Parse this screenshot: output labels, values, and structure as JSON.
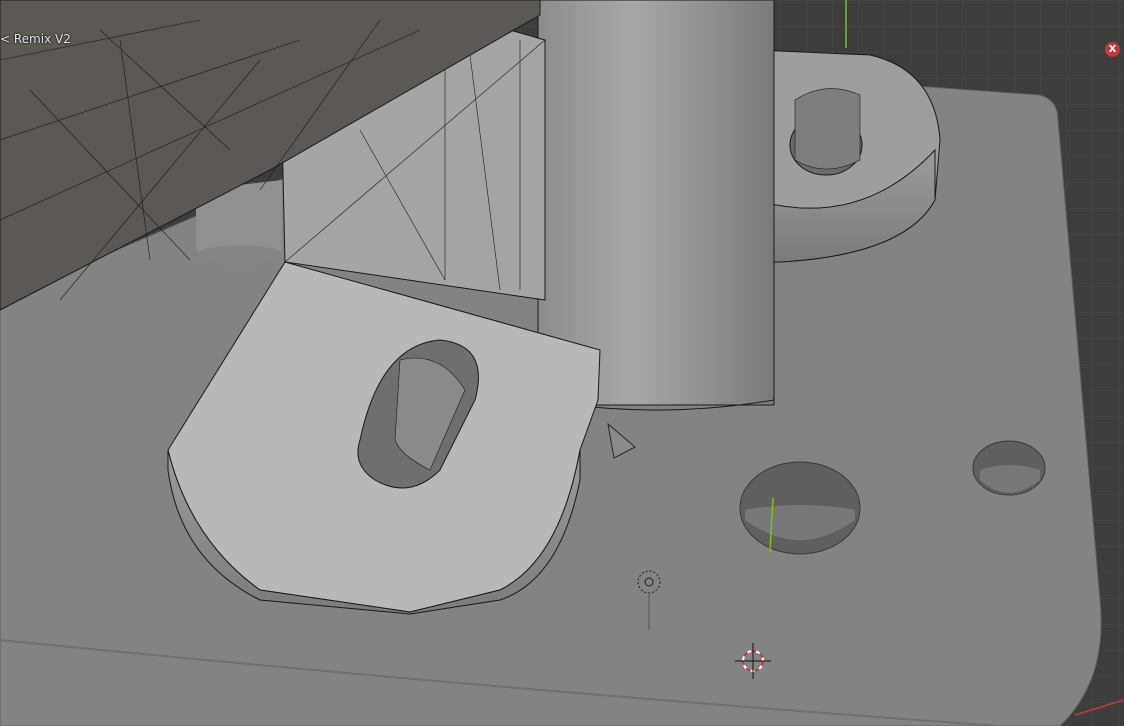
{
  "viewport": {
    "object_label": "< Remix V2",
    "gizmo": {
      "x_axis_label": "X"
    }
  },
  "colors": {
    "background": "#3d3d3d",
    "grid_line": "#4a4a4a",
    "base_plate": "#838383",
    "mesh_light": "#b4b4b4",
    "mesh_mid": "#9a9a9a",
    "mesh_dark": "#6e6e6e",
    "dark_object": "#5c5954",
    "wire": "#1a1a1a",
    "y_axis": "#7fbf1f",
    "x_axis": "#c23a3a"
  }
}
